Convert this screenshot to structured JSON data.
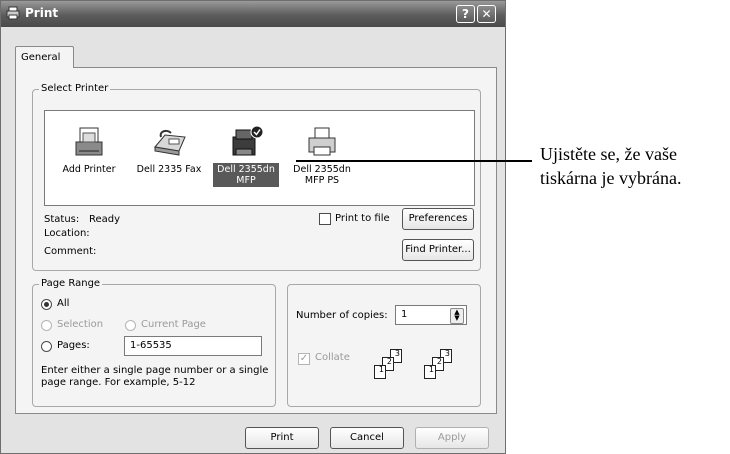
{
  "window": {
    "title": "Print",
    "help_label": "?",
    "close_label": "✕"
  },
  "tabs": [
    {
      "label": "General"
    }
  ],
  "select_printer": {
    "legend": "Select Printer",
    "printers": [
      {
        "label1": "Add Printer",
        "label2": "",
        "selected": false
      },
      {
        "label1": "Dell 2335 Fax",
        "label2": "",
        "selected": false
      },
      {
        "label1": "Dell 2355dn",
        "label2": "MFP",
        "selected": true
      },
      {
        "label1": "Dell 2355dn",
        "label2": "MFP PS",
        "selected": false
      }
    ],
    "status_label": "Status:",
    "status_value": "Ready",
    "location_label": "Location:",
    "comment_label": "Comment:",
    "print_to_file_label": "Print to file",
    "preferences_label": "Preferences",
    "find_printer_label": "Find Printer..."
  },
  "page_range": {
    "legend": "Page Range",
    "all_label": "All",
    "selection_label": "Selection",
    "current_page_label": "Current Page",
    "pages_label": "Pages:",
    "pages_value": "1-65535",
    "hint_line1": "Enter either a single page number or a single",
    "hint_line2": "page range.  For example, 5-12"
  },
  "copies": {
    "number_label": "Number of copies:",
    "number_value": "1",
    "collate_label": "Collate",
    "collate_pages": [
      "1",
      "2",
      "3"
    ]
  },
  "footer": {
    "print_label": "Print",
    "cancel_label": "Cancel",
    "apply_label": "Apply"
  },
  "annotation": {
    "line1": "Ujistěte se, že vaše",
    "line2": "tiskárna je vybrána."
  }
}
